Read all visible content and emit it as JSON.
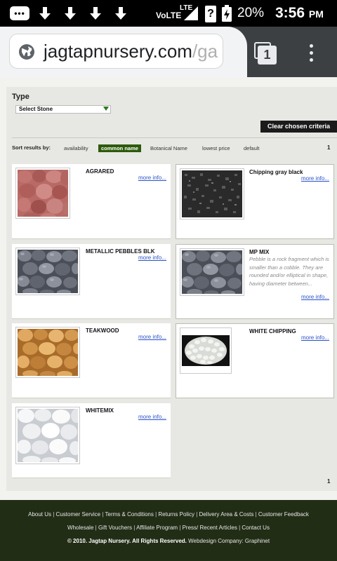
{
  "status_bar": {
    "network": "VoLTE",
    "lte": "LTE",
    "battery_percent": "20%",
    "time": "3:56",
    "ampm": "PM",
    "message_icon_text": "•••",
    "unknown_icon_text": "?"
  },
  "browser": {
    "url_main": "jagtapnursery.com",
    "url_faded": "/ga",
    "tab_count": "1"
  },
  "filter": {
    "type_label": "Type",
    "select_value": "Select Stone",
    "clear_button": "Clear chosen criteria"
  },
  "sort": {
    "label": "Sort results by:",
    "options": [
      "availability",
      "common name",
      "Botanical Name",
      "lowest price",
      "default"
    ],
    "active_option": "common name",
    "page_top": "1",
    "page_bottom": "1"
  },
  "products": [
    {
      "name": "AGRARED",
      "more": "more info...",
      "image": "red-pebbles"
    },
    {
      "name": "Chipping gray black",
      "more": "more info...",
      "image": "gray-chips"
    },
    {
      "name": "METALLIC PEBBLES BLK",
      "more": "more info...",
      "image": "metallic-pebbles"
    },
    {
      "name": "MP MIX",
      "more": "more info...",
      "image": "metallic-pebbles",
      "description": "Pebble is a rock fragment which is smaller than a cobble. They are rounded and/or elliptical in shape, having diameter between..."
    },
    {
      "name": "TEAKWOOD",
      "more": "more info...",
      "image": "teak-pebbles"
    },
    {
      "name": "WHITE CHIPPING",
      "more": "more info...",
      "image": "white-chips"
    },
    {
      "name": "WHITEMIX",
      "more": "more info...",
      "image": "white-pebbles"
    }
  ],
  "footer": {
    "line1": [
      "About Us",
      "Customer Service",
      "Terms & Conditions",
      "Returns Policy",
      "Delivery Area & Costs",
      "Customer Feedback"
    ],
    "line2": [
      "Wholesale",
      "Gift Vouchers",
      "Affiliate Program",
      "Press/ Recent Articles",
      "Contact Us"
    ],
    "copyright": "© 2010. Jagtap Nursery. All Rights Reserved.",
    "credit": "Webdesign Company: Graphinet"
  },
  "colors": {
    "footer_bg": "#222d16",
    "active_sort_bg": "#2d5a0c",
    "link": "#2b52c9"
  }
}
